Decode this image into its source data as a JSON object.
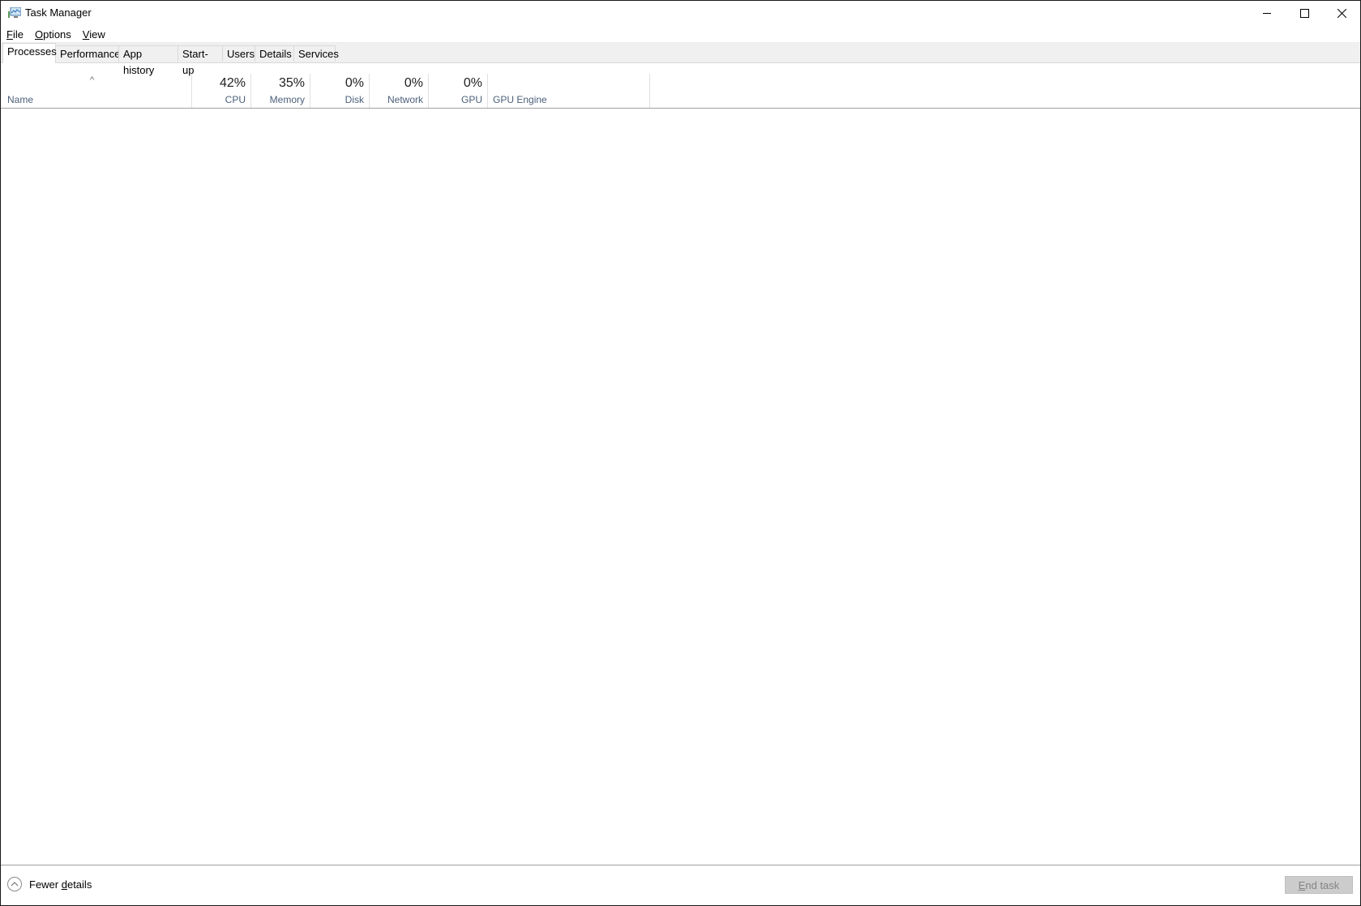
{
  "window": {
    "title": "Task Manager",
    "controls": {
      "minimize": "minimize-icon",
      "maximize": "maximize-icon",
      "close": "close-icon"
    }
  },
  "menubar": {
    "items": [
      {
        "label": "File",
        "accel": "F",
        "rest": "ile"
      },
      {
        "label": "Options",
        "accel": "O",
        "rest": "ptions"
      },
      {
        "label": "View",
        "accel": "V",
        "rest": "iew"
      }
    ]
  },
  "tabs": [
    {
      "label": "Processes",
      "active": true
    },
    {
      "label": "Performance"
    },
    {
      "label": "App history"
    },
    {
      "label": "Start-up"
    },
    {
      "label": "Users"
    },
    {
      "label": "Details"
    },
    {
      "label": "Services"
    }
  ],
  "columns": {
    "name": {
      "label": "Name",
      "sort": "ascending"
    },
    "cpu": {
      "pct": "42%",
      "label": "CPU"
    },
    "memory": {
      "pct": "35%",
      "label": "Memory"
    },
    "disk": {
      "pct": "0%",
      "label": "Disk"
    },
    "network": {
      "pct": "0%",
      "label": "Network"
    },
    "gpu": {
      "pct": "0%",
      "label": "GPU"
    },
    "gpu_engine": {
      "label": "GPU Engine"
    }
  },
  "footer": {
    "fewer_details": {
      "pre": "Fewer ",
      "accel": "d",
      "post": "etails"
    },
    "end_task": {
      "accel": "E",
      "rest": "nd task",
      "enabled": false
    }
  }
}
